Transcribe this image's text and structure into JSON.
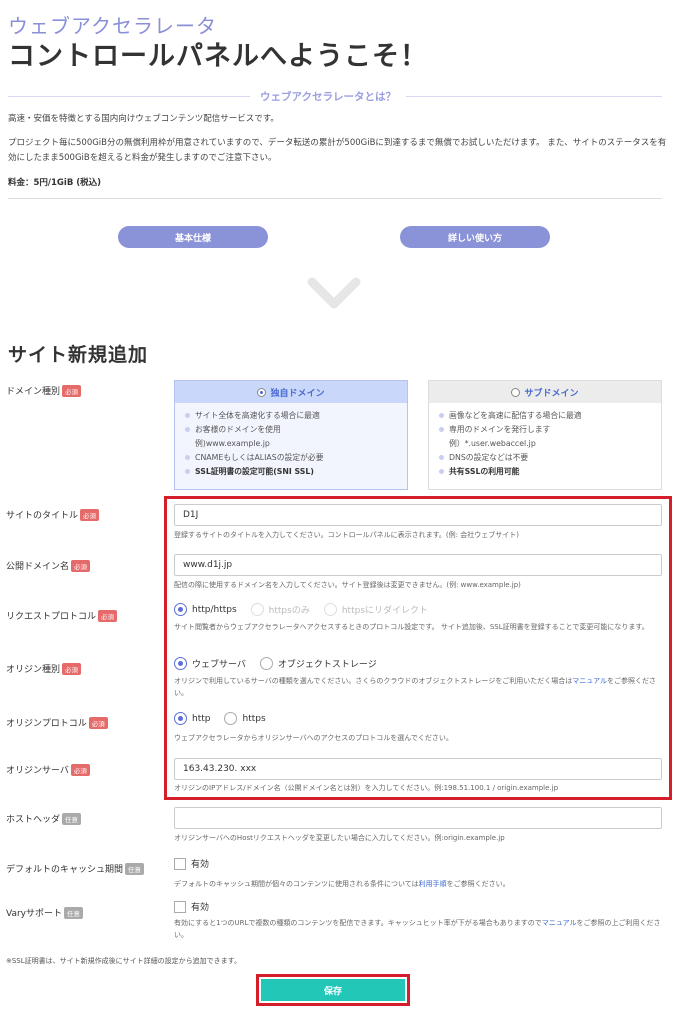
{
  "header": {
    "subtitle": "ウェブアクセラレータ",
    "title": "コントロールパネルへようこそ！"
  },
  "about": {
    "label": "ウェブアクセラレータとは？",
    "p1": "高速・安価を特徴とする国内向けウェブコンテンツ配信サービスです。",
    "p2": "プロジェクト毎に500GiB分の無償利用枠が用意されていますので、データ転送の累計が500GiBに到達するまで無償でお試しいただけます。 また、サイトのステータスを有効にしたまま500GiBを超えると料金が発生しますのでご注意下さい。",
    "price": "料金：5円/1GiB (税込)",
    "basic_button": "基本仕様",
    "usage_button": "詳しい使い方"
  },
  "form": {
    "section_title": "サイト新規追加",
    "required_badge": "必須",
    "optional_badge": "任意",
    "domain_type": {
      "label": "ドメイン種別",
      "own": {
        "title": "独自ドメイン",
        "items": [
          "サイト全体を高速化する場合に最適",
          "お客様のドメインを使用",
          "例)www.example.jp",
          "CNAMEもしくはALIASの設定が必要",
          "SSL証明書の設定可能(SNI SSL)"
        ]
      },
      "sub": {
        "title": "サブドメイン",
        "items": [
          "画像などを高速に配信する場合に最適",
          "専用のドメインを発行します",
          "例）*.user.webaccel.jp",
          "DNSの設定などは不要",
          "共有SSLの利用可能"
        ]
      }
    },
    "site_title": {
      "label": "サイトのタイトル",
      "value": "D1J",
      "help": "登録するサイトのタイトルを入力してください。コントロールパネルに表示されます。(例: 会社ウェブサイト)"
    },
    "public_domain": {
      "label": "公開ドメイン名",
      "value": "www.d1j.jp",
      "help": "配信の際に使用するドメイン名を入力してください。サイト登録後は変更できません。(例: www.example.jp)"
    },
    "request_protocol": {
      "label": "リクエストプロトコル",
      "options": [
        "http/https",
        "httpsのみ",
        "httpsにリダイレクト"
      ],
      "help": "サイト閲覧者からウェブアクセラレータへアクセスするときのプロトコル設定です。 サイト追加後、SSL証明書を登録することで変更可能になります。"
    },
    "origin_type": {
      "label": "オリジン種別",
      "options": [
        "ウェブサーバ",
        "オブジェクトストレージ"
      ],
      "help_a": "オリジンで利用しているサーバの種類を選んでください。さくらのクラウドのオブジェクトストレージをご利用いただく場合は",
      "help_link": "マニュアル",
      "help_b": "をご参照ください。"
    },
    "origin_protocol": {
      "label": "オリジンプロトコル",
      "options": [
        "http",
        "https"
      ],
      "help": "ウェブアクセラレータからオリジンサーバへのアクセスのプロトコルを選んでください。"
    },
    "origin_server": {
      "label": "オリジンサーバ",
      "value": "163.43.230. xxx",
      "help": "オリジンのIPアドレス/ドメイン名（公開ドメイン名とは別）を入力してください。例:198.51.100.1 / origin.example.jp"
    },
    "host_header": {
      "label": "ホストヘッダ",
      "value": "",
      "help": "オリジンサーバへのHostリクエストヘッダを変更したい場合に入力してください。例:origin.example.jp"
    },
    "cache_period": {
      "label": "デフォルトのキャッシュ期間",
      "checkbox": "有効",
      "help_a": "デフォルトのキャッシュ期間が個々のコンテンツに使用される条件については",
      "help_link": "利用手順",
      "help_b": "をご参照ください。"
    },
    "vary": {
      "label": "Varyサポート",
      "checkbox": "有効",
      "help_a": "有効にすると1つのURLで複数の種類のコンテンツを配信できます。キャッシュヒット率が下がる場合もありますので",
      "help_link": "マニュアル",
      "help_b": "をご参照の上ご利用ください。"
    },
    "ssl_note": "※SSL証明書は、サイト新規作成後にサイト詳細の設定から追加できます。",
    "save_button": "保存"
  }
}
